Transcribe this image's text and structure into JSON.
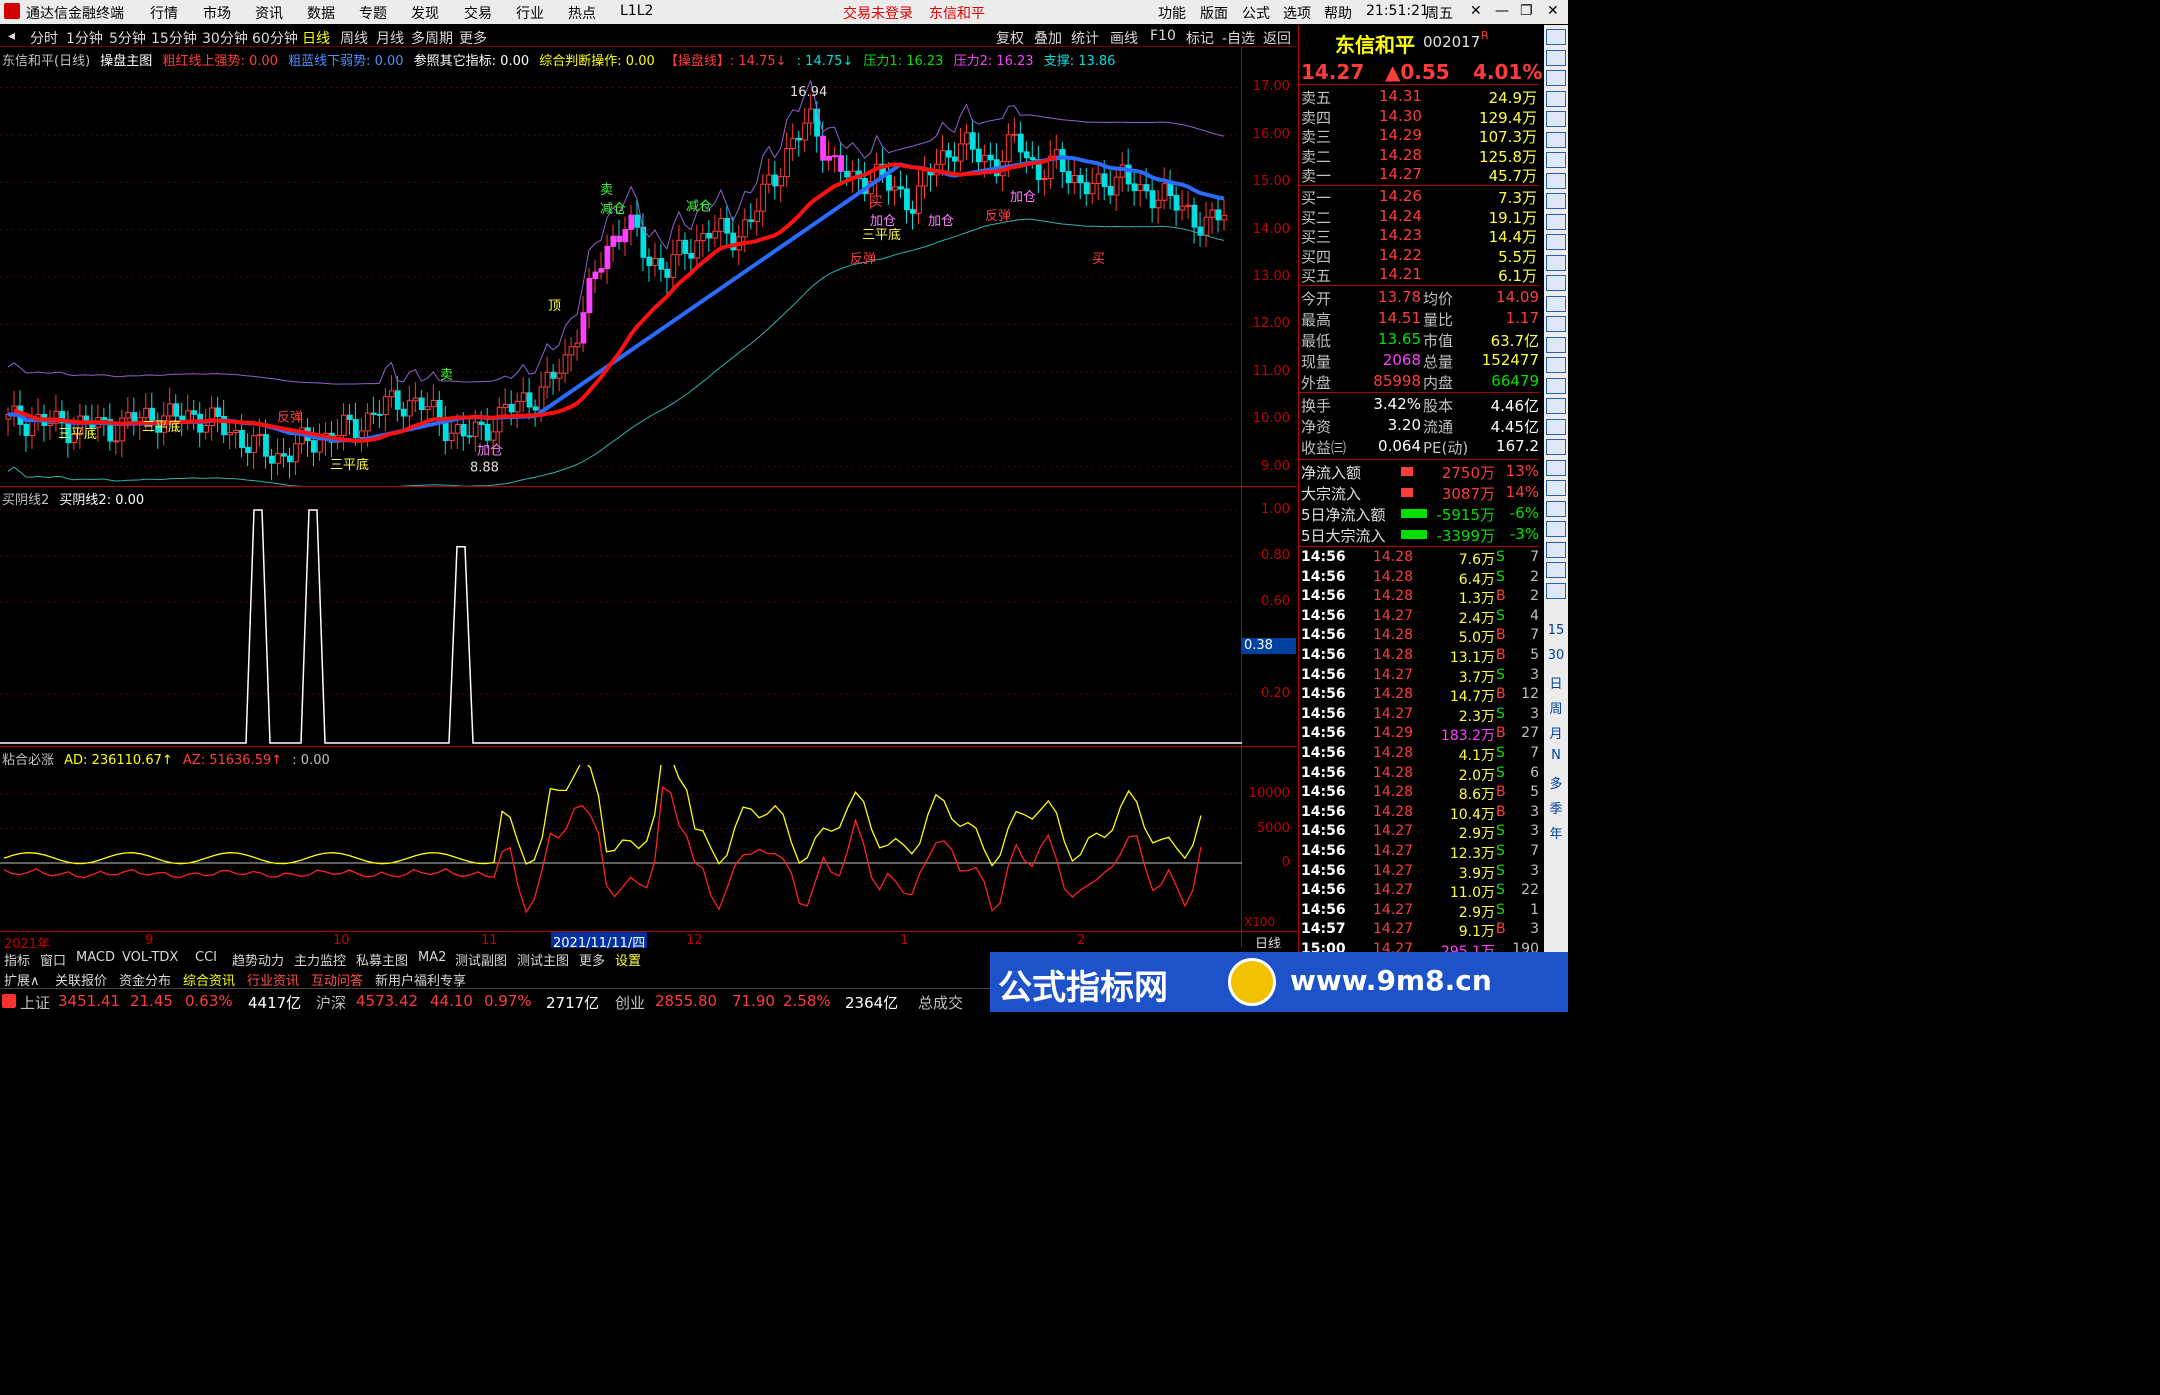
{
  "menubar": {
    "app_title": "通达信金融终端",
    "items": [
      "行情",
      "市场",
      "资讯",
      "数据",
      "专题",
      "发现",
      "交易",
      "行业",
      "热点",
      "L1L2"
    ],
    "login_status": "交易未登录",
    "stock_name": "东信和平",
    "right_items": [
      "功能",
      "版面",
      "公式",
      "选项",
      "帮助"
    ],
    "clock": "21:51:21",
    "weekday": "周五"
  },
  "periods": {
    "items": [
      "分时",
      "1分钟",
      "5分钟",
      "15分钟",
      "30分钟",
      "60分钟",
      "日线",
      "周线",
      "月线",
      "多周期",
      "更多"
    ],
    "active": "日线",
    "tools": [
      "复权",
      "叠加",
      "统计",
      "画线",
      "F10",
      "标记",
      "-自选",
      "返回"
    ]
  },
  "main_chart": {
    "info": {
      "name": "东信和平(日线)",
      "formula": "操盘主图",
      "red_label": "粗红线上强势: 0.00",
      "blue_label": "粗蓝线下弱势: 0.00",
      "ref_label": "参照其它指标: 0.00",
      "judge_label": "综合判断操作: 0.00",
      "line_label": "【操盘线】: 14.75↓",
      "val2": ": 14.75↓",
      "p1": "压力1: 16.23",
      "p2": "压力2: 16.23",
      "support": "支撑: 13.86"
    },
    "y_ticks": [
      "17.00",
      "16.00",
      "15.00",
      "14.00",
      "13.00",
      "12.00",
      "11.00",
      "10.00",
      "9.00"
    ],
    "annotations": {
      "high": "16.94",
      "low": "8.88",
      "sanpingdi": "三平底",
      "fantan": "反弹",
      "jiacang": "加仓",
      "jiancang": "减仓",
      "mai_sell": "卖",
      "mai_buy": "买",
      "ding": "顶"
    }
  },
  "ind1": {
    "label": "买阴线2",
    "value": "买阴线2: 0.00",
    "y_ticks": [
      "1.00",
      "0.80",
      "0.60",
      "0.20"
    ],
    "cursor_value": "0.38"
  },
  "ind2": {
    "label": "粘合必涨",
    "ad": "AD: 236110.67↑",
    "az": "AZ: 51636.59↑",
    "extra": ": 0.00",
    "y_ticks": [
      "10000",
      "5000",
      "0"
    ],
    "scale": "X100"
  },
  "xaxis": {
    "labels": [
      "2021年",
      "9",
      "10",
      "11",
      "2021/11/11/四",
      "12",
      "1",
      "2"
    ],
    "period": "日线"
  },
  "quote": {
    "name": "东信和平",
    "code": "002017",
    "flag": "R",
    "price": "14.27",
    "change": "▲0.55",
    "pct": "4.01%",
    "asks": [
      {
        "label": "卖五",
        "price": "14.31",
        "vol": "24.9万"
      },
      {
        "label": "卖四",
        "price": "14.30",
        "vol": "129.4万"
      },
      {
        "label": "卖三",
        "price": "14.29",
        "vol": "107.3万"
      },
      {
        "label": "卖二",
        "price": "14.28",
        "vol": "125.8万"
      },
      {
        "label": "卖一",
        "price": "14.27",
        "vol": "45.7万"
      }
    ],
    "bids": [
      {
        "label": "买一",
        "price": "14.26",
        "vol": "7.3万"
      },
      {
        "label": "买二",
        "price": "14.24",
        "vol": "19.1万"
      },
      {
        "label": "买三",
        "price": "14.23",
        "vol": "14.4万"
      },
      {
        "label": "买四",
        "price": "14.22",
        "vol": "5.5万"
      },
      {
        "label": "买五",
        "price": "14.21",
        "vol": "6.1万"
      }
    ],
    "stats": [
      {
        "l1": "今开",
        "v1": "13.78",
        "l2": "均价",
        "v2": "14.09"
      },
      {
        "l1": "最高",
        "v1": "14.51",
        "l2": "量比",
        "v2": "1.17"
      },
      {
        "l1": "最低",
        "v1": "13.65",
        "l2": "市值",
        "v2": "63.7亿"
      },
      {
        "l1": "现量",
        "v1": "2068",
        "l2": "总量",
        "v2": "152477"
      },
      {
        "l1": "外盘",
        "v1": "85998",
        "l2": "内盘",
        "v2": "66479"
      }
    ],
    "stats2": [
      {
        "l1": "换手",
        "v1": "3.42%",
        "l2": "股本",
        "v2": "4.46亿"
      },
      {
        "l1": "净资",
        "v1": "3.20",
        "l2": "流通",
        "v2": "4.45亿"
      },
      {
        "l1": "收益㈢",
        "v1": "0.064",
        "l2": "PE(动)",
        "v2": "167.2"
      }
    ],
    "flows": [
      {
        "label": "净流入额",
        "value": "2750万",
        "pct": "13%",
        "color": "r"
      },
      {
        "label": "大宗流入",
        "value": "3087万",
        "pct": "14%",
        "color": "r"
      },
      {
        "label": "5日净流入额",
        "value": "-5915万",
        "pct": "-6%",
        "color": "g"
      },
      {
        "label": "5日大宗流入",
        "value": "-3399万",
        "pct": "-3%",
        "color": "g"
      }
    ],
    "ticks": [
      [
        "14:56",
        "14.28",
        "7.6万",
        "S",
        "7"
      ],
      [
        "14:56",
        "14.28",
        "6.4万",
        "S",
        "2"
      ],
      [
        "14:56",
        "14.28",
        "1.3万",
        "B",
        "2"
      ],
      [
        "14:56",
        "14.27",
        "2.4万",
        "S",
        "4"
      ],
      [
        "14:56",
        "14.28",
        "5.0万",
        "B",
        "7"
      ],
      [
        "14:56",
        "14.28",
        "13.1万",
        "B",
        "5"
      ],
      [
        "14:56",
        "14.27",
        "3.7万",
        "S",
        "3"
      ],
      [
        "14:56",
        "14.28",
        "14.7万",
        "B",
        "12"
      ],
      [
        "14:56",
        "14.27",
        "2.3万",
        "S",
        "3"
      ],
      [
        "14:56",
        "14.29",
        "183.2万",
        "B",
        "27"
      ],
      [
        "14:56",
        "14.28",
        "4.1万",
        "S",
        "7"
      ],
      [
        "14:56",
        "14.28",
        "2.0万",
        "S",
        "6"
      ],
      [
        "14:56",
        "14.28",
        "8.6万",
        "B",
        "5"
      ],
      [
        "14:56",
        "14.28",
        "10.4万",
        "B",
        "3"
      ],
      [
        "14:56",
        "14.27",
        "2.9万",
        "S",
        "3"
      ],
      [
        "14:56",
        "14.27",
        "12.3万",
        "S",
        "7"
      ],
      [
        "14:56",
        "14.27",
        "3.9万",
        "S",
        "3"
      ],
      [
        "14:56",
        "14.27",
        "11.0万",
        "S",
        "22"
      ],
      [
        "14:56",
        "14.27",
        "2.9万",
        "S",
        "1"
      ],
      [
        "14:57",
        "14.27",
        "9.1万",
        "B",
        "3"
      ],
      [
        "15:00",
        "14.27",
        "295.1万",
        "",
        "190"
      ]
    ]
  },
  "vtabs": [
    "15",
    "30",
    "日",
    "周",
    "月",
    "N",
    "多",
    "季",
    "年"
  ],
  "bottom_tabs": [
    "指标",
    "窗口",
    "MACD",
    "VOL-TDX",
    "CCI",
    "趋势动力",
    "主力监控",
    "私募主图",
    "MA2",
    "测试副图",
    "测试主图",
    "更多",
    "设置"
  ],
  "bottom_tabs2": [
    "扩展∧",
    "关联报价",
    "资金分布",
    "综合资讯",
    "行业资讯",
    "互动问答",
    "新用户福利专享"
  ],
  "status": {
    "sh_label": "上证",
    "sh_val": "3451.41",
    "sh_chg": "21.45",
    "sh_pct": "0.63%",
    "sh_amt": "4417亿",
    "hs_label": "沪深",
    "hs_val": "4573.42",
    "hs_chg": "44.10",
    "hs_pct": "0.97%",
    "hs_amt": "2717亿",
    "cy_label": "创业",
    "cy_val": "2855.80",
    "cy_chg": "71.90",
    "cy_pct": "2.58%",
    "cy_amt": "2364亿",
    "total": "总成交"
  },
  "ad_banner": {
    "title": "公式指标网",
    "url": "www.9m8.cn"
  },
  "chart_data": {
    "type": "candlestick",
    "title": "东信和平(日线)",
    "x_labels": [
      "2021年",
      "9",
      "10",
      "11",
      "12",
      "1",
      "2"
    ],
    "ylim": [
      8.8,
      17.2
    ],
    "closes": [
      9.95,
      10.0,
      9.9,
      9.85,
      9.9,
      9.8,
      9.95,
      10.1,
      10.0,
      10.1,
      9.9,
      9.7,
      9.4,
      9.2,
      9.4,
      9.6,
      9.7,
      9.9,
      10.2,
      10.4,
      10.3,
      10.0,
      9.6,
      9.8,
      10.1,
      10.4,
      10.6,
      11.2,
      12.4,
      13.6,
      14.2,
      13.4,
      13.2,
      13.6,
      14.0,
      13.8,
      14.2,
      15.0,
      15.8,
      16.3,
      15.4,
      15.0,
      15.2,
      14.8,
      14.6,
      15.4,
      15.8,
      15.6,
      15.4,
      15.9,
      15.2,
      15.4,
      15.0,
      14.8,
      15.3,
      14.6,
      14.9,
      14.3,
      14.2,
      14.27
    ],
    "ma_red_label": "粗红线上强势",
    "ma_blue_label": "粗蓝线下弱势"
  }
}
